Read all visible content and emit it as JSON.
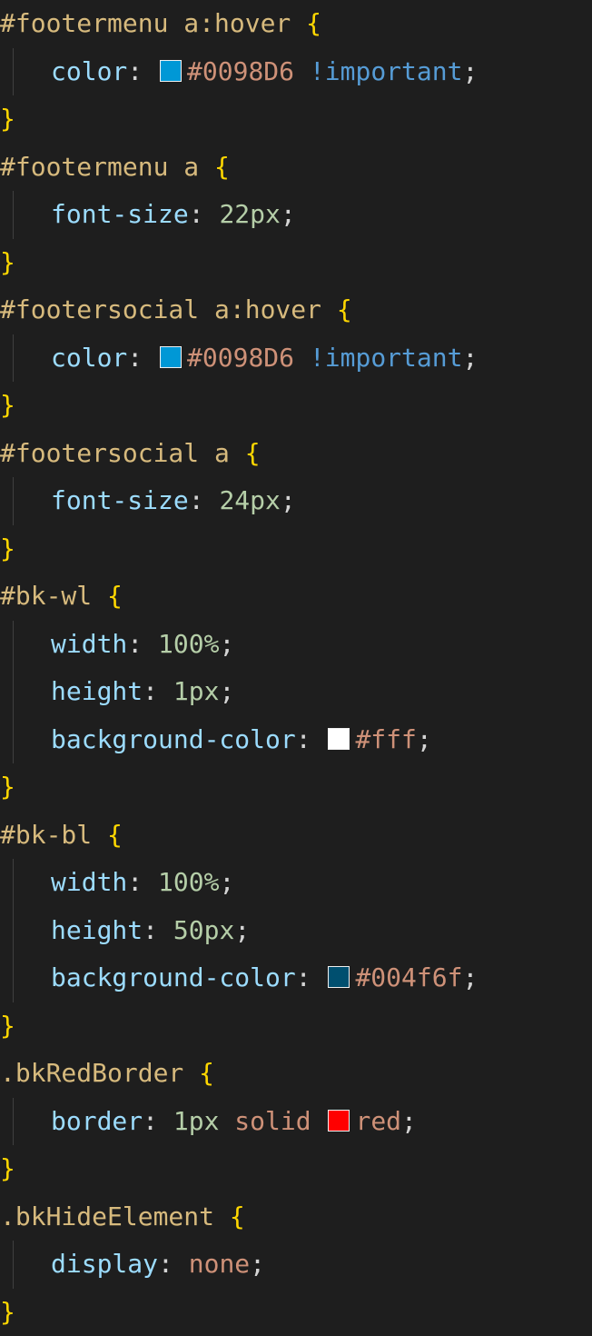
{
  "lines": [
    {
      "indent": false,
      "tokens": [
        {
          "t": "#footermenu a:hover ",
          "c": "sel"
        },
        {
          "t": "{",
          "c": "brace"
        }
      ]
    },
    {
      "indent": true,
      "tokens": [
        {
          "t": "color",
          "c": "prop"
        },
        {
          "t": ": ",
          "c": "plain"
        },
        {
          "swatch": "#0098D6"
        },
        {
          "t": "#0098D6",
          "c": "str"
        },
        {
          "t": " !important",
          "c": "kw"
        },
        {
          "t": ";",
          "c": "plain"
        }
      ]
    },
    {
      "indent": false,
      "tokens": [
        {
          "t": "}",
          "c": "brace"
        }
      ]
    },
    {
      "indent": false,
      "tokens": [
        {
          "t": "#footermenu a ",
          "c": "sel"
        },
        {
          "t": "{",
          "c": "brace"
        }
      ]
    },
    {
      "indent": true,
      "tokens": [
        {
          "t": "font-size",
          "c": "prop"
        },
        {
          "t": ": ",
          "c": "plain"
        },
        {
          "t": "22px",
          "c": "num"
        },
        {
          "t": ";",
          "c": "plain"
        }
      ]
    },
    {
      "indent": false,
      "tokens": [
        {
          "t": "}",
          "c": "brace"
        }
      ]
    },
    {
      "indent": false,
      "tokens": [
        {
          "t": "#footersocial a:hover ",
          "c": "sel"
        },
        {
          "t": "{",
          "c": "brace"
        }
      ]
    },
    {
      "indent": true,
      "tokens": [
        {
          "t": "color",
          "c": "prop"
        },
        {
          "t": ": ",
          "c": "plain"
        },
        {
          "swatch": "#0098D6"
        },
        {
          "t": "#0098D6",
          "c": "str"
        },
        {
          "t": " !important",
          "c": "kw"
        },
        {
          "t": ";",
          "c": "plain"
        }
      ]
    },
    {
      "indent": false,
      "tokens": [
        {
          "t": "}",
          "c": "brace"
        }
      ]
    },
    {
      "indent": false,
      "tokens": [
        {
          "t": "#footersocial a ",
          "c": "sel"
        },
        {
          "t": "{",
          "c": "brace"
        }
      ]
    },
    {
      "indent": true,
      "tokens": [
        {
          "t": "font-size",
          "c": "prop"
        },
        {
          "t": ": ",
          "c": "plain"
        },
        {
          "t": "24px",
          "c": "num"
        },
        {
          "t": ";",
          "c": "plain"
        }
      ]
    },
    {
      "indent": false,
      "tokens": [
        {
          "t": "}",
          "c": "brace"
        }
      ]
    },
    {
      "indent": false,
      "tokens": [
        {
          "t": "#bk-wl ",
          "c": "sel"
        },
        {
          "t": "{",
          "c": "brace"
        }
      ]
    },
    {
      "indent": true,
      "tokens": [
        {
          "t": "width",
          "c": "prop"
        },
        {
          "t": ": ",
          "c": "plain"
        },
        {
          "t": "100%",
          "c": "num"
        },
        {
          "t": ";",
          "c": "plain"
        }
      ]
    },
    {
      "indent": true,
      "tokens": [
        {
          "t": "height",
          "c": "prop"
        },
        {
          "t": ": ",
          "c": "plain"
        },
        {
          "t": "1px",
          "c": "num"
        },
        {
          "t": ";",
          "c": "plain"
        }
      ]
    },
    {
      "indent": true,
      "tokens": [
        {
          "t": "background-color",
          "c": "prop"
        },
        {
          "t": ": ",
          "c": "plain"
        },
        {
          "swatch": "#ffffff"
        },
        {
          "t": "#fff",
          "c": "str"
        },
        {
          "t": ";",
          "c": "plain"
        }
      ]
    },
    {
      "indent": false,
      "tokens": [
        {
          "t": "}",
          "c": "brace"
        }
      ]
    },
    {
      "indent": false,
      "tokens": [
        {
          "t": "#bk-bl ",
          "c": "sel"
        },
        {
          "t": "{",
          "c": "brace"
        }
      ]
    },
    {
      "indent": true,
      "tokens": [
        {
          "t": "width",
          "c": "prop"
        },
        {
          "t": ": ",
          "c": "plain"
        },
        {
          "t": "100%",
          "c": "num"
        },
        {
          "t": ";",
          "c": "plain"
        }
      ]
    },
    {
      "indent": true,
      "tokens": [
        {
          "t": "height",
          "c": "prop"
        },
        {
          "t": ": ",
          "c": "plain"
        },
        {
          "t": "50px",
          "c": "num"
        },
        {
          "t": ";",
          "c": "plain"
        }
      ]
    },
    {
      "indent": true,
      "tokens": [
        {
          "t": "background-color",
          "c": "prop"
        },
        {
          "t": ": ",
          "c": "plain"
        },
        {
          "swatch": "#004f6f"
        },
        {
          "t": "#004f6f",
          "c": "str"
        },
        {
          "t": ";",
          "c": "plain"
        }
      ]
    },
    {
      "indent": false,
      "tokens": [
        {
          "t": "}",
          "c": "brace"
        }
      ]
    },
    {
      "indent": false,
      "tokens": [
        {
          "t": ".bkRedBorder ",
          "c": "sel"
        },
        {
          "t": "{",
          "c": "brace"
        }
      ]
    },
    {
      "indent": true,
      "tokens": [
        {
          "t": "border",
          "c": "prop"
        },
        {
          "t": ": ",
          "c": "plain"
        },
        {
          "t": "1px",
          "c": "num"
        },
        {
          "t": " solid ",
          "c": "str"
        },
        {
          "swatch": "#ff0000"
        },
        {
          "t": "red",
          "c": "str"
        },
        {
          "t": ";",
          "c": "plain"
        }
      ]
    },
    {
      "indent": false,
      "tokens": [
        {
          "t": "}",
          "c": "brace"
        }
      ]
    },
    {
      "indent": false,
      "tokens": [
        {
          "t": ".bkHideElement ",
          "c": "sel"
        },
        {
          "t": "{",
          "c": "brace"
        }
      ]
    },
    {
      "indent": true,
      "tokens": [
        {
          "t": "display",
          "c": "prop"
        },
        {
          "t": ": ",
          "c": "plain"
        },
        {
          "t": "none",
          "c": "str"
        },
        {
          "t": ";",
          "c": "plain"
        }
      ]
    },
    {
      "indent": false,
      "tokens": [
        {
          "t": "}",
          "c": "brace"
        }
      ]
    }
  ]
}
